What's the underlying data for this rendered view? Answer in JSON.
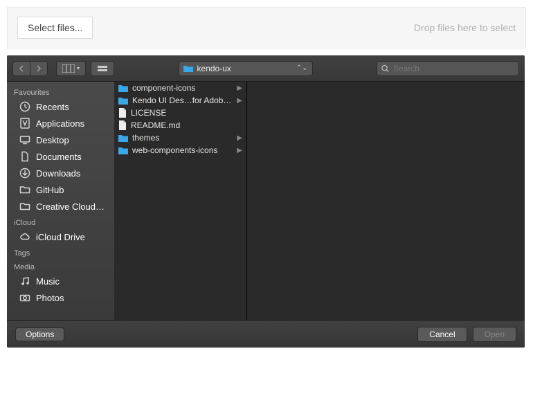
{
  "dropzone": {
    "select_label": "Select files...",
    "hint": "Drop files here to select"
  },
  "toolbar": {
    "current_folder": "kendo-ux",
    "search_placeholder": "Search"
  },
  "sidebar": {
    "sections": [
      {
        "label": "Favourites",
        "items": [
          {
            "label": "Recents",
            "icon": "clock"
          },
          {
            "label": "Applications",
            "icon": "apps"
          },
          {
            "label": "Desktop",
            "icon": "desktop"
          },
          {
            "label": "Documents",
            "icon": "document"
          },
          {
            "label": "Downloads",
            "icon": "download"
          },
          {
            "label": "GitHub",
            "icon": "folder"
          },
          {
            "label": "Creative Cloud…",
            "icon": "folder"
          }
        ]
      },
      {
        "label": "iCloud",
        "items": [
          {
            "label": "iCloud Drive",
            "icon": "cloud"
          }
        ]
      },
      {
        "label": "Tags",
        "items": []
      },
      {
        "label": "Media",
        "items": [
          {
            "label": "Music",
            "icon": "music"
          },
          {
            "label": "Photos",
            "icon": "camera"
          }
        ]
      }
    ]
  },
  "files": [
    {
      "name": "component-icons",
      "type": "folder",
      "hasChildren": true
    },
    {
      "name": "Kendo UI Des…for Adobe XD",
      "type": "folder",
      "hasChildren": true
    },
    {
      "name": "LICENSE",
      "type": "file",
      "hasChildren": false
    },
    {
      "name": "README.md",
      "type": "file",
      "hasChildren": false
    },
    {
      "name": "themes",
      "type": "folder",
      "hasChildren": true
    },
    {
      "name": "web-components-icons",
      "type": "folder",
      "hasChildren": true
    }
  ],
  "footer": {
    "options": "Options",
    "cancel": "Cancel",
    "open": "Open"
  },
  "colors": {
    "folder_blue": "#3aa8e6"
  }
}
